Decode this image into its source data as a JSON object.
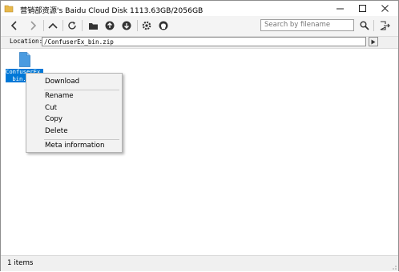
{
  "window": {
    "title": "营销部资源's Baidu Cloud Disk 1113.63GB/2056GB"
  },
  "toolbar": {
    "search_placeholder": "Search by filename",
    "buttons": [
      "back",
      "forward",
      "up",
      "refresh",
      "new-folder",
      "upload",
      "download",
      "settings",
      "github",
      "search",
      "logout"
    ]
  },
  "location": {
    "label": "Location:",
    "path": "/ConfuserEx_bin.zip"
  },
  "files": [
    {
      "name_line1": "ConfuserEx_",
      "name_line2": "bin.zip",
      "selected": true
    }
  ],
  "context_menu": {
    "items": [
      "Download",
      "Rename",
      "Cut",
      "Copy",
      "Delete",
      "Meta information"
    ]
  },
  "status": {
    "text": "1 items"
  },
  "colors": {
    "selection": "#0078d7",
    "menu_bg": "#f2f2f2",
    "toolbar_bg": "#f4f4f4"
  }
}
